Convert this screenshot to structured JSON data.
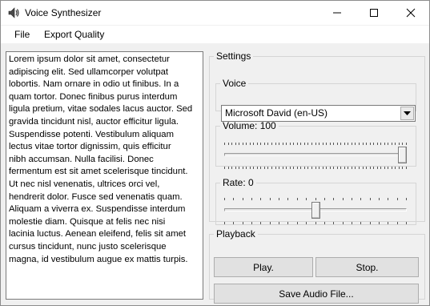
{
  "window": {
    "title": "Voice Synthesizer",
    "icon": "speaker-icon"
  },
  "menu": {
    "file": "File",
    "export_quality": "Export Quality"
  },
  "editor": {
    "text": "Lorem ipsum dolor sit amet, consectetur\nadipiscing elit. Sed ullamcorper volutpat\nlobortis. Nam ornare in odio ut finibus. In a\nquam tortor. Donec finibus purus interdum\nligula pretium, vitae sodales lacus auctor. Sed\ngravida tincidunt nisl, auctor efficitur ligula.\nSuspendisse potenti. Vestibulum aliquam\nlectus vitae tortor dignissim, quis efficitur\nnibh accumsan. Nulla facilisi. Donec\nfermentum est sit amet scelerisque tincidunt.\nUt nec nisl venenatis, ultrices orci vel,\nhendrerit dolor. Fusce sed venenatis quam.\nAliquam a viverra ex. Suspendisse interdum\nmolestie diam. Quisque at felis nec nisi\nlacinia luctus. Aenean eleifend, felis sit amet\ncursus tincidunt, nunc justo scelerisque\nmagna, id vestibulum augue ex mattis turpis."
  },
  "settings": {
    "legend": "Settings",
    "voice": {
      "legend": "Voice",
      "selected": "Microsoft David (en-US)"
    },
    "volume": {
      "legend": "Volume: 100",
      "value": 100,
      "min": 0,
      "max": 100
    },
    "rate": {
      "legend": "Rate: 0",
      "value": 0,
      "min": -10,
      "max": 10
    }
  },
  "playback": {
    "legend": "Playback",
    "play": "Play.",
    "stop": "Stop.",
    "save": "Save Audio File..."
  }
}
